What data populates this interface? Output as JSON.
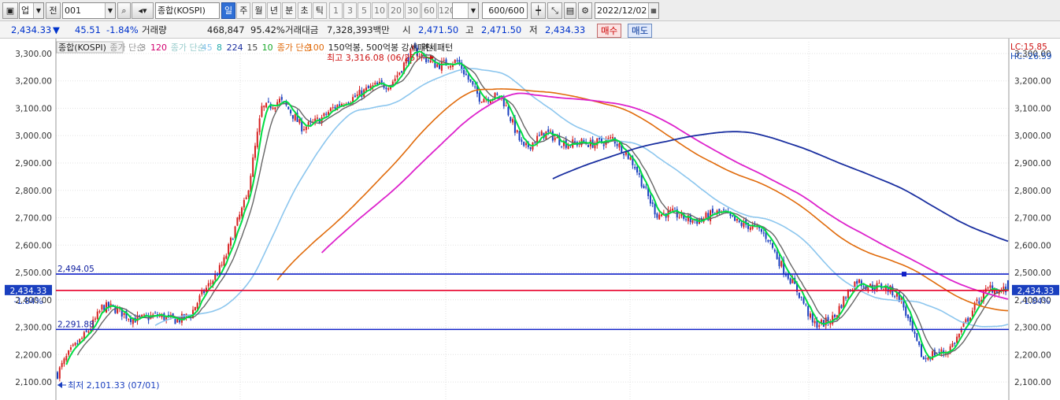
{
  "toolbar": {
    "type_value": "업",
    "prev_label": "전",
    "code_value": "001",
    "name_value": "종합(KOSPI)",
    "periods": [
      "일",
      "주",
      "월",
      "년",
      "분",
      "초",
      "틱"
    ],
    "active_period": "일",
    "intervals": [
      "1",
      "3",
      "5",
      "10",
      "20",
      "30",
      "60",
      "120"
    ],
    "count_value": "600/600",
    "date_value": "2022/12/02"
  },
  "info": {
    "price": "2,434.33",
    "change_arrow": "▼",
    "change": "45.51",
    "change_pct": "-1.84%",
    "volume_label": "거래량",
    "volume": "468,847",
    "volume_pct": "95.42%",
    "amount_label": "거래대금",
    "amount": "7,328,393백만",
    "open_label": "시",
    "open": "2,471.50",
    "high_label": "고",
    "high": "2,471.50",
    "low_label": "저",
    "low": "2,434.33",
    "buy_label": "매수",
    "sell_label": "매도"
  },
  "colors": {
    "up": "#d62020",
    "down": "#1a3fbf",
    "ma3": "#d1006f",
    "ma5": "#1aa82a",
    "ma10": "#666666",
    "ma15": "#00dd44",
    "ma20": "#22bb22",
    "ma45": "#8cc6ee",
    "ma100": "#e06a0a",
    "ma120": "#dd22cc",
    "ma224": "#1a2fa0",
    "hline_blue": "#1020c8",
    "hline_red": "#e8002a"
  },
  "chart_data": {
    "type": "candlestick",
    "title": "종합(KOSPI)",
    "period": "daily",
    "ylim": [
      2080,
      3340
    ],
    "yticks": [
      "2,100.00",
      "2,200.00",
      "2,300.00",
      "2,400.00",
      "2,500.00",
      "2,600.00",
      "2,700.00",
      "2,800.00",
      "2,900.00",
      "3,000.00",
      "3,100.00",
      "3,200.00",
      "3,300.00"
    ],
    "grid": true,
    "legend_position": "top-left",
    "legend": {
      "series_name": "종합(KOSPI)",
      "ma_short_label": "종가 단순",
      "ma_short_periods": [
        "3",
        "120"
      ],
      "ma_mid_label": "종가 단순",
      "ma_mid_periods": [
        "45",
        "8",
        "224",
        "15",
        "10"
      ],
      "ma_long_label": "종가 단순",
      "ma_long_period": "100",
      "pattern_text": "150억봉, 500억봉 강세패턴",
      "weak_pattern_text": "약세패턴"
    },
    "price_labels": {
      "upper_line": "2,494.05",
      "lower_line": "2,291.88",
      "current": "2,434.33",
      "current_pct": "-1.84%",
      "right_current": "2,434.33",
      "right_pct": "-1.84%",
      "lc": "LC:15.85",
      "hc": "HC:-26.59"
    },
    "annotations": {
      "high": "최고 3,316.08 (06/25)",
      "low": "최저 2,101.33 (07/01)"
    },
    "horizontal_lines": {
      "upper": 2494.05,
      "current": 2434.33,
      "lower": 2291.88
    },
    "key_points": [
      [
        0,
        2130
      ],
      [
        20,
        2370
      ],
      [
        40,
        2330
      ],
      [
        60,
        2340
      ],
      [
        75,
        2550
      ],
      [
        85,
        2760
      ],
      [
        92,
        3110
      ],
      [
        100,
        3120
      ],
      [
        110,
        3040
      ],
      [
        120,
        3060
      ],
      [
        130,
        3140
      ],
      [
        140,
        3160
      ],
      [
        150,
        3200
      ],
      [
        160,
        3300
      ],
      [
        170,
        3270
      ],
      [
        180,
        3260
      ],
      [
        190,
        3150
      ],
      [
        200,
        3130
      ],
      [
        210,
        2960
      ],
      [
        220,
        3000
      ],
      [
        230,
        2980
      ],
      [
        240,
        2960
      ],
      [
        250,
        3000
      ],
      [
        260,
        2880
      ],
      [
        270,
        2720
      ],
      [
        280,
        2700
      ],
      [
        290,
        2700
      ],
      [
        300,
        2710
      ],
      [
        310,
        2680
      ],
      [
        320,
        2620
      ],
      [
        330,
        2480
      ],
      [
        340,
        2310
      ],
      [
        350,
        2340
      ],
      [
        360,
        2470
      ],
      [
        370,
        2450
      ],
      [
        380,
        2400
      ],
      [
        390,
        2180
      ],
      [
        400,
        2210
      ],
      [
        410,
        2330
      ],
      [
        420,
        2450
      ],
      [
        428,
        2440
      ]
    ]
  }
}
